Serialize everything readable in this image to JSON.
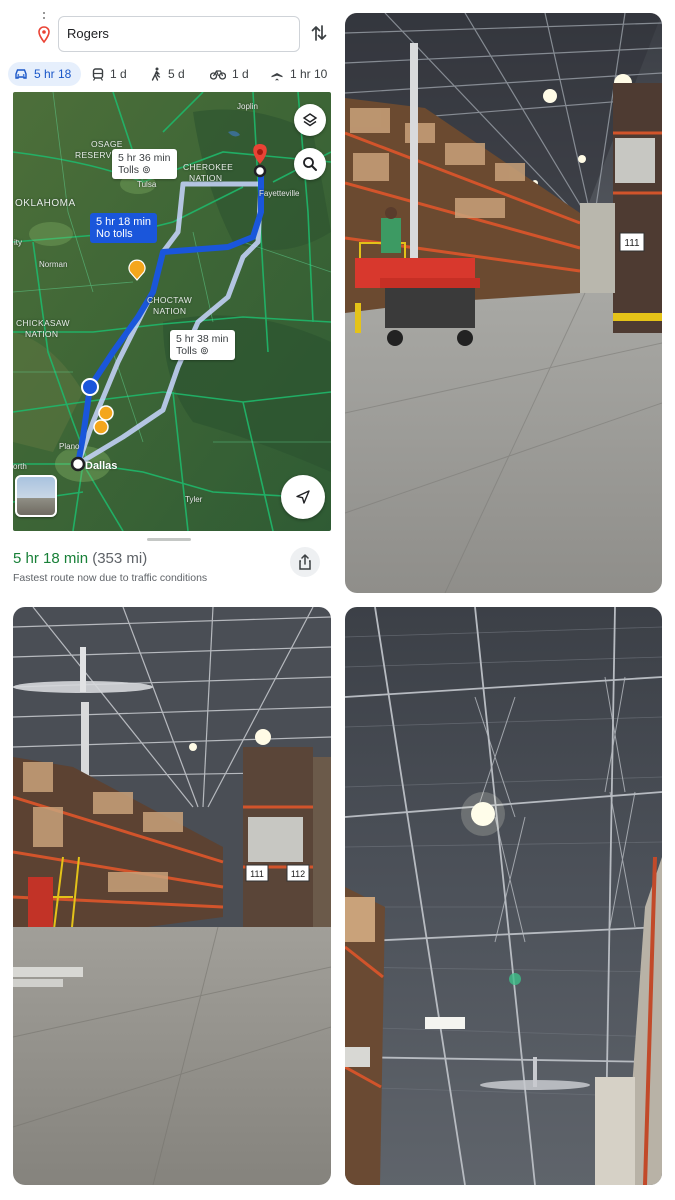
{
  "search": {
    "destination": "Rogers"
  },
  "modes": [
    {
      "icon": "car-icon",
      "label": "5 hr 18"
    },
    {
      "icon": "transit-icon",
      "label": "1 d"
    },
    {
      "icon": "walk-icon",
      "label": "5 d"
    },
    {
      "icon": "bike-icon",
      "label": "1 d"
    },
    {
      "icon": "flight-icon",
      "label": "1 hr 10"
    }
  ],
  "map": {
    "route_labels": {
      "alt1_time": "5 hr 36 min",
      "alt1_sub": "Tolls",
      "main_time": "5 hr 18 min",
      "main_sub": "No tolls",
      "alt2_time": "5 hr 38 min",
      "alt2_sub": "Tolls"
    },
    "places": {
      "osage": "OSAGE",
      "reserve": "RESERVE",
      "cherokee": "CHEROKEE",
      "cherokee_nation": "NATION",
      "oklahoma": "OKLAHOMA",
      "choctaw": "CHOCTAW",
      "choctaw_nation": "NATION",
      "chickasaw": "CHICKASAW",
      "chickasaw_nation": "NATION"
    },
    "cities": {
      "joplin": "Joplin",
      "tulsa": "Tulsa",
      "fayetteville": "Fayetteville",
      "norman": "Norman",
      "plano": "Plano",
      "dallas": "Dallas",
      "tyler": "Tyler",
      "ity": "ity",
      "orth": "orth"
    }
  },
  "summary": {
    "time": "5 hr 18 min",
    "distance": "(353 mi)",
    "note": "Fastest route now due to traffic conditions"
  },
  "photos": {
    "aisle_signs": [
      "111",
      "111",
      "112"
    ]
  },
  "colors": {
    "route": "#1a56db",
    "time_green": "#188038",
    "pin_red": "#ea4335"
  }
}
